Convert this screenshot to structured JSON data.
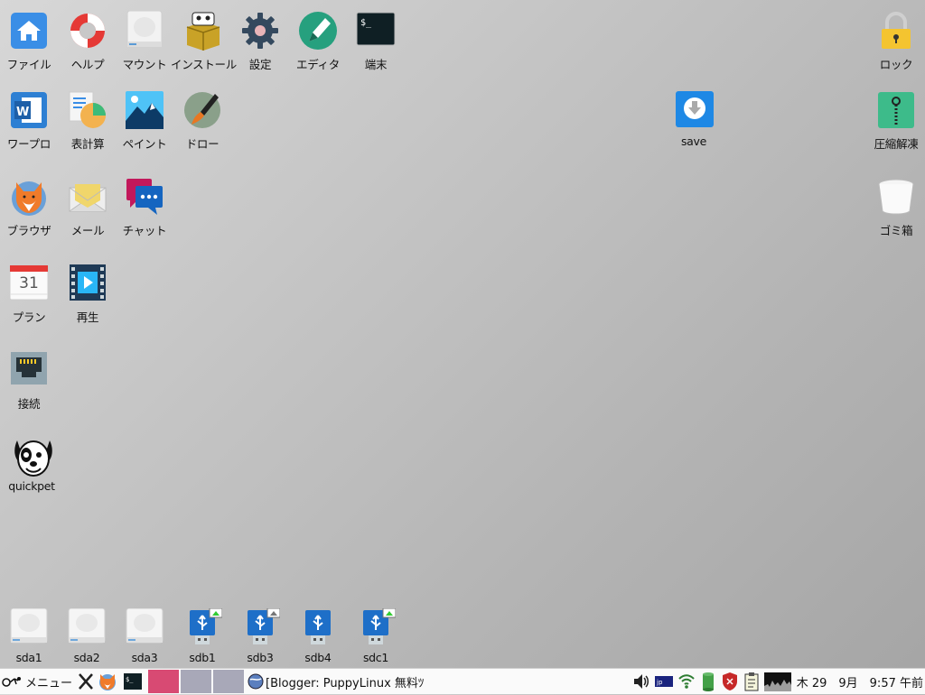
{
  "desktop_icons": {
    "file": "ファイル",
    "help": "ヘルプ",
    "mount": "マウント",
    "install": "インストール",
    "settings": "設定",
    "editor": "エディタ",
    "terminal": "端末",
    "lock": "ロック",
    "wordpro": "ワープロ",
    "spreadsheet": "表計算",
    "paint": "ペイント",
    "draw": "ドロー",
    "save": "save",
    "unzip": "圧縮解凍",
    "browser": "ブラウザ",
    "mail": "メール",
    "chat": "チャット",
    "trash": "ゴミ箱",
    "plan": "プラン",
    "play": "再生",
    "connect": "接続",
    "quickpet": "quickpet",
    "calendar_day": "31"
  },
  "drives": [
    "sda1",
    "sda2",
    "sda3",
    "sdb1",
    "sdb3",
    "sdb4",
    "sdc1"
  ],
  "taskbar": {
    "menu_label": "メニュー",
    "window_title": "[Blogger: PuppyLinux 無料ﾂ",
    "clock": "木 29　9月　9:57 午前"
  },
  "colors": {
    "accent_blue": "#1e88e5",
    "taskbar_pink": "#d84a73",
    "taskbar_gray": "#a8a8b8"
  }
}
